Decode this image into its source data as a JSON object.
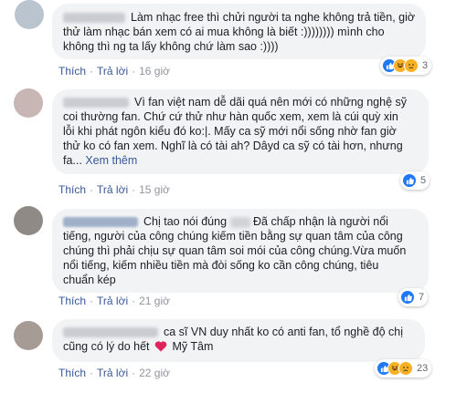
{
  "colors": {
    "link": "#385898",
    "bubble": "#f2f3f5",
    "like_blue": "#2078f4",
    "haha_yellow": "#f7b125",
    "heart_red": "#e0245e"
  },
  "actions": {
    "like": "Thích",
    "reply": "Trả lời",
    "separator": "·",
    "see_more": "Xem thêm"
  },
  "comments": [
    {
      "lines": [
        "Làm nhạc free thì chửi người ta nghe không trả tiền, giờ",
        "thử làm nhạc bán xem có ai mua không là biết :)))))))) mình cho",
        "không thì ng ta lấy không chứ làm sao :))))"
      ],
      "time": "16 giờ",
      "reactions": [
        "like-icon",
        "haha-icon",
        "sad-icon"
      ],
      "reaction_count": "3"
    },
    {
      "lines": [
        "Vì fan việt nam dễ dãi quá nên mới có những nghệ sỹ",
        "coi thường fan. Chứ cứ thử như hàn quốc xem, xem là cúi quỳ xin",
        "lỗi khi phát ngôn kiểu đó ko:|. Mấy ca sỹ mới nổi sống nhờ fan giờ",
        "thử ko có fan xem. Nghĩ là có tài ah? Dâyd ca sỹ có tài hơn, nhưng",
        "fa..."
      ],
      "time": "15 giờ",
      "reactions": [
        "like-icon"
      ],
      "reaction_count": "5"
    },
    {
      "author_text": "Trần Ngọc Trang",
      "lines": [
        "Chị tao nói đúng",
        "Đã chấp nhận là người nổi",
        "tiếng, người của công chúng kiếm tiền bằng sự quan tâm của công",
        "chúng thì phải chịu sự quan tâm soi mói của công chúng.Vừa muốn",
        "nổi tiếng, kiếm nhiều tiền mà đòi sống ko cần công chúng, tiêu",
        "chuẩn kép"
      ],
      "time": "21 giờ",
      "reactions": [
        "like-icon"
      ],
      "reaction_count": "7"
    },
    {
      "lines": [
        "ca sĩ VN duy nhất ko có anti fan, tổ nghề độ chị",
        "cũng có lý do hết",
        "Mỹ Tâm"
      ],
      "time": "22 giờ",
      "reactions": [
        "like-icon",
        "haha-icon",
        "sad-icon"
      ],
      "reaction_count": "23"
    }
  ]
}
